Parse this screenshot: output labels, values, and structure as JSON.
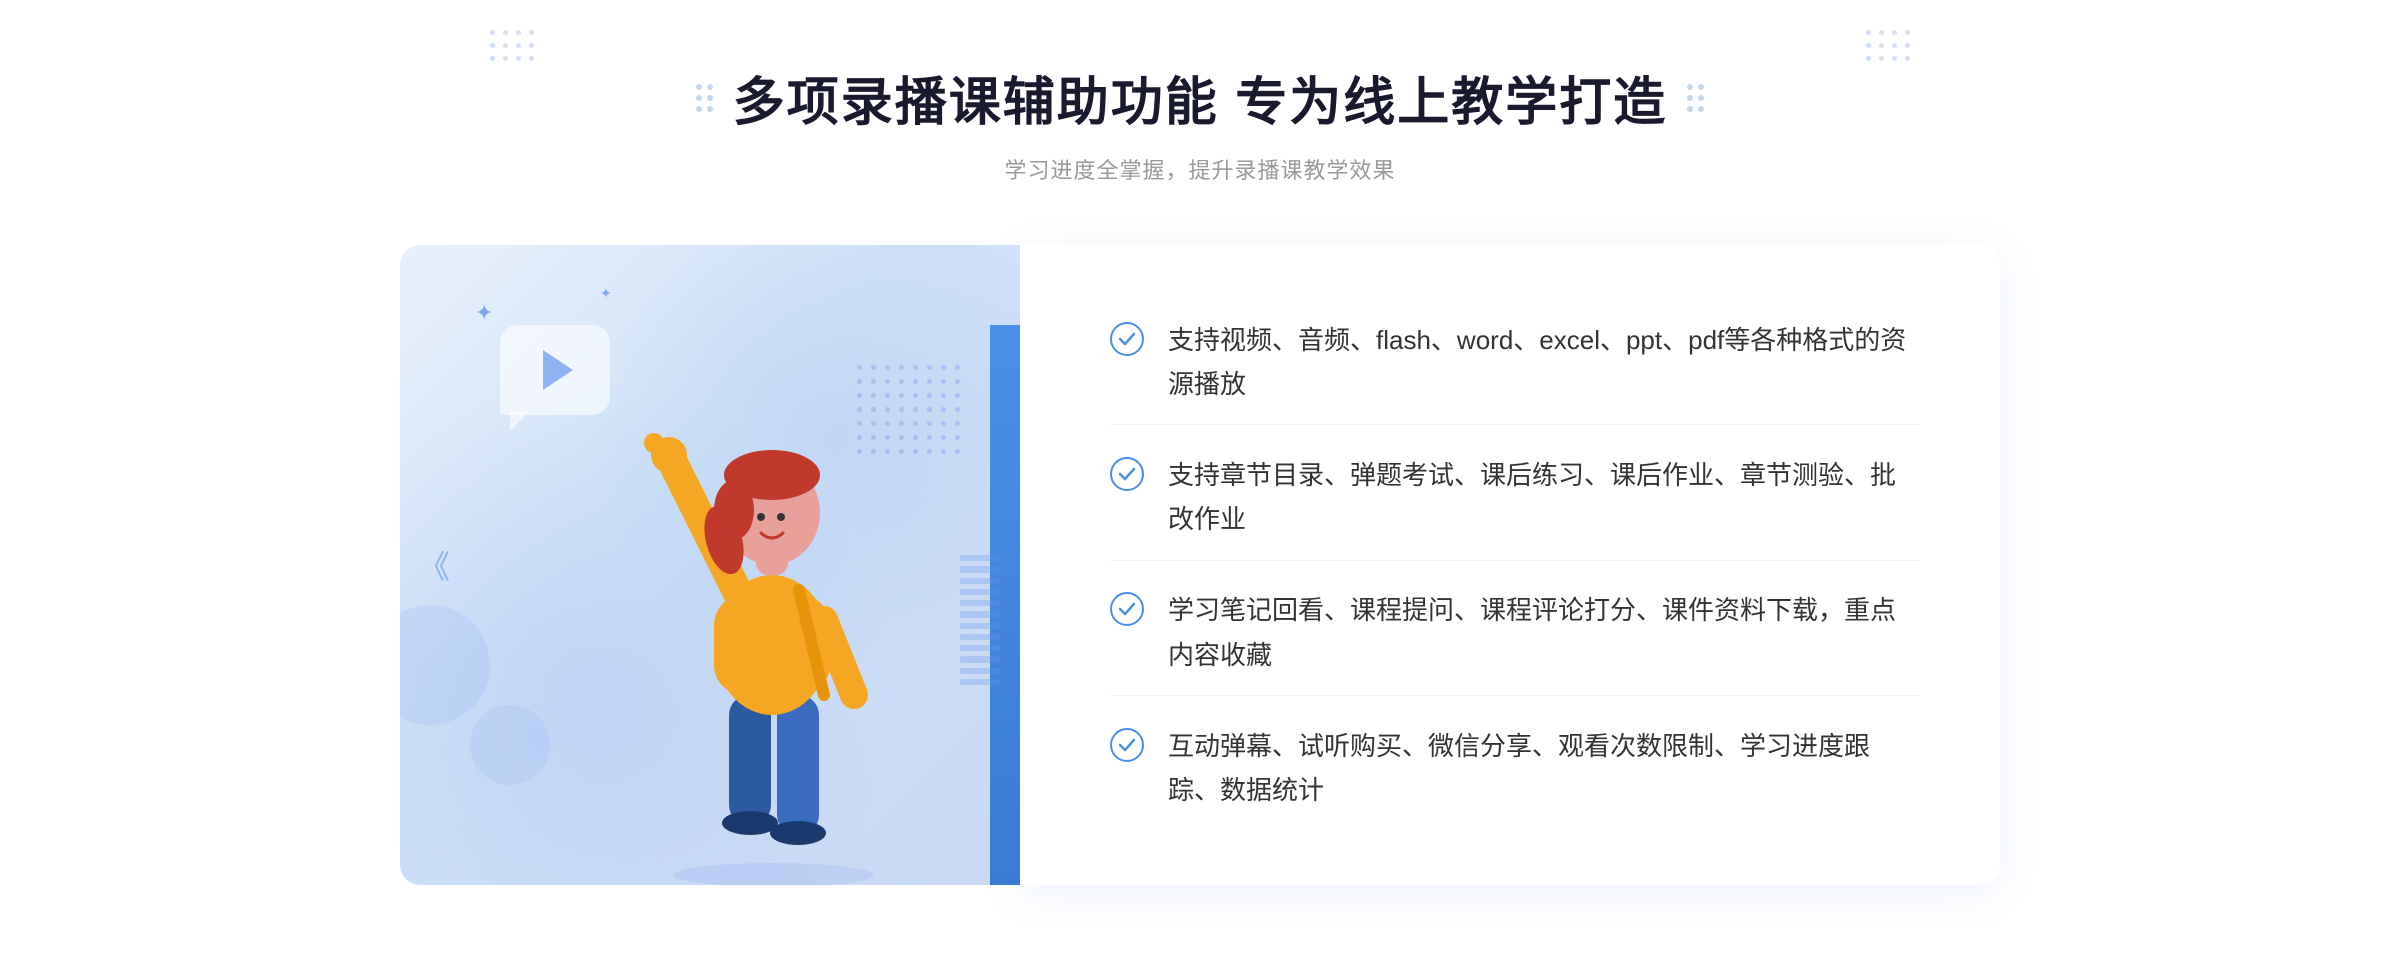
{
  "header": {
    "title": "多项录播课辅助功能 专为线上教学打造",
    "subtitle": "学习进度全掌握，提升录播课教学效果"
  },
  "features": [
    {
      "id": "feature-1",
      "text": "支持视频、音频、flash、word、excel、ppt、pdf等各种格式的资源播放"
    },
    {
      "id": "feature-2",
      "text": "支持章节目录、弹题考试、课后练习、课后作业、章节测验、批改作业"
    },
    {
      "id": "feature-3",
      "text": "学习笔记回看、课程提问、课程评论打分、课件资料下载，重点内容收藏"
    },
    {
      "id": "feature-4",
      "text": "互动弹幕、试听购买、微信分享、观看次数限制、学习进度跟踪、数据统计"
    }
  ],
  "colors": {
    "primary": "#4a90e8",
    "text_dark": "#1a1a2e",
    "text_gray": "#999",
    "text_body": "#333",
    "bg_light": "#e8f0fc",
    "check_color": "#4a90e8"
  }
}
